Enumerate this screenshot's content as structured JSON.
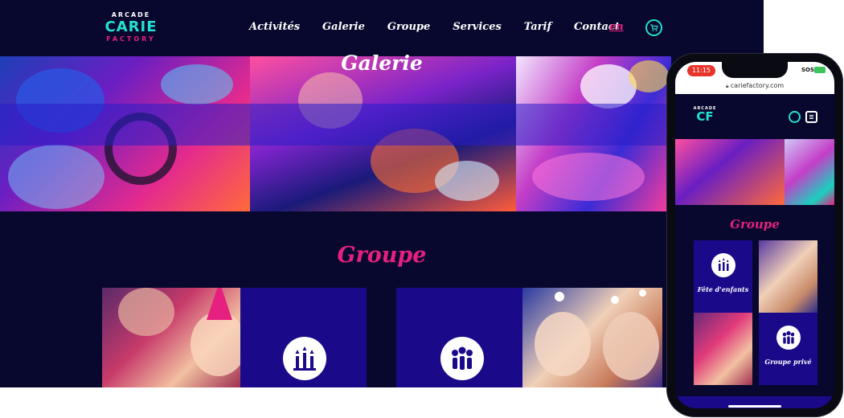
{
  "desktop": {
    "logo": {
      "line1": "ARCADE",
      "line2": "CARIE",
      "line3": "FACTORY"
    },
    "nav": [
      "Activités",
      "Galerie",
      "Groupe",
      "Services",
      "Tarif",
      "Contact"
    ],
    "language": "en",
    "cart_icon": "cart-icon",
    "hero_title": "Galerie",
    "section_title": "Groupe"
  },
  "phone": {
    "time": "11:15",
    "signal": "SOS",
    "url": "cariefactory.com",
    "logo": {
      "line1": "ARCADE",
      "line2": "CF"
    },
    "section_title": "Groupe",
    "cards": [
      {
        "label": "Fête d'enfants",
        "icon": "birthday-candles-icon"
      },
      {
        "label": "Groupe privé",
        "icon": "group-people-icon"
      }
    ]
  },
  "colors": {
    "background": "#08082e",
    "accent_pink": "#e6207f",
    "accent_teal": "#23e0d0",
    "card_blue": "#1a0a8a"
  }
}
